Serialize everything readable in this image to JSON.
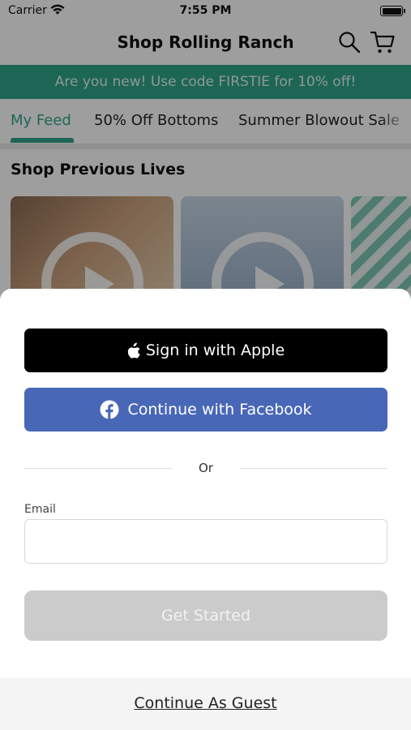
{
  "status_bar": {
    "carrier": "Carrier",
    "time": "7:55 PM"
  },
  "nav": {
    "title": "Shop Rolling Ranch"
  },
  "promo": {
    "text": "Are you new! Use code FIRSTIE for 10% off!"
  },
  "tabs": [
    {
      "label": "My Feed",
      "active": true
    },
    {
      "label": "50% Off Bottoms",
      "active": false
    },
    {
      "label": "Summer Blowout Sale",
      "active": false
    }
  ],
  "section": {
    "title": "Shop Previous Lives"
  },
  "colors": {
    "accent": "#2fa58a",
    "facebook": "#4867b7",
    "apple": "#000000",
    "disabled": "#cbcbcb"
  },
  "sheet": {
    "apple_label": "Sign in with Apple",
    "facebook_label": "Continue with Facebook",
    "divider_text": "Or",
    "email_label": "Email",
    "email_value": "",
    "get_started_label": "Get Started",
    "guest_label": "Continue As Guest"
  }
}
